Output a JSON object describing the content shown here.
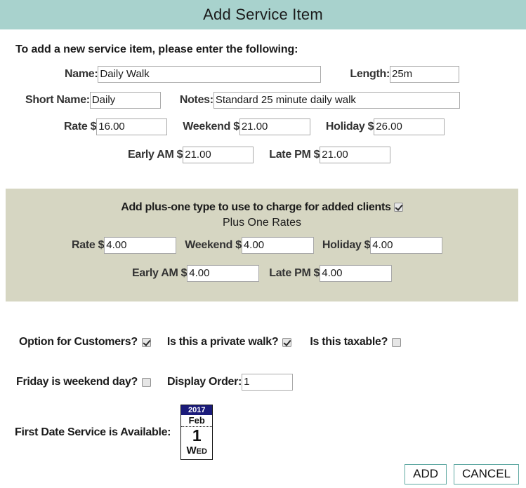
{
  "window": {
    "title": "Add Service Item",
    "header_color": "#a8d2cd"
  },
  "form": {
    "intro": "To add a new service item, please enter the following:",
    "fields": {
      "name_label": "Name:",
      "name_value": "Daily Walk",
      "length_label": "Length:",
      "length_value": "25m",
      "short_name_label": "Short Name:",
      "short_name_value": "Daily",
      "notes_label": "Notes:",
      "notes_value": "Standard 25 minute daily walk",
      "rate_label": "Rate $",
      "rate_value": "16.00",
      "weekend_label": "Weekend $",
      "weekend_value": "21.00",
      "holiday_label": "Holiday $",
      "holiday_value": "26.00",
      "early_am_label": "Early AM $",
      "early_am_value": "21.00",
      "late_pm_label": "Late PM $",
      "late_pm_value": "21.00"
    }
  },
  "plus_one": {
    "panel_color": "#d6d6c2",
    "title": "Add plus-one type to use to charge for added clients",
    "enabled": true,
    "subtitle": "Plus One Rates",
    "rate_label": "Rate $",
    "rate_value": "4.00",
    "weekend_label": "Weekend $",
    "weekend_value": "4.00",
    "holiday_label": "Holiday $",
    "holiday_value": "4.00",
    "early_am_label": "Early AM $",
    "early_am_value": "4.00",
    "late_pm_label": "Late PM $",
    "late_pm_value": "4.00"
  },
  "options": {
    "customer_option_label": "Option for Customers?",
    "customer_option_checked": true,
    "private_walk_label": "Is this a private walk?",
    "private_walk_checked": true,
    "taxable_label": "Is this taxable?",
    "taxable_checked": false,
    "friday_weekend_label": "Friday is weekend day?",
    "friday_weekend_checked": false,
    "display_order_label": "Display Order:",
    "display_order_value": "1"
  },
  "first_date": {
    "label": "First Date Service is Available:",
    "year": "2017",
    "month": "Feb",
    "day": "1",
    "weekday_first": "W",
    "weekday_rest": "ED"
  },
  "buttons": {
    "add_label": "ADD",
    "cancel_label": "CANCEL",
    "border_color": "#5fa9a2"
  }
}
